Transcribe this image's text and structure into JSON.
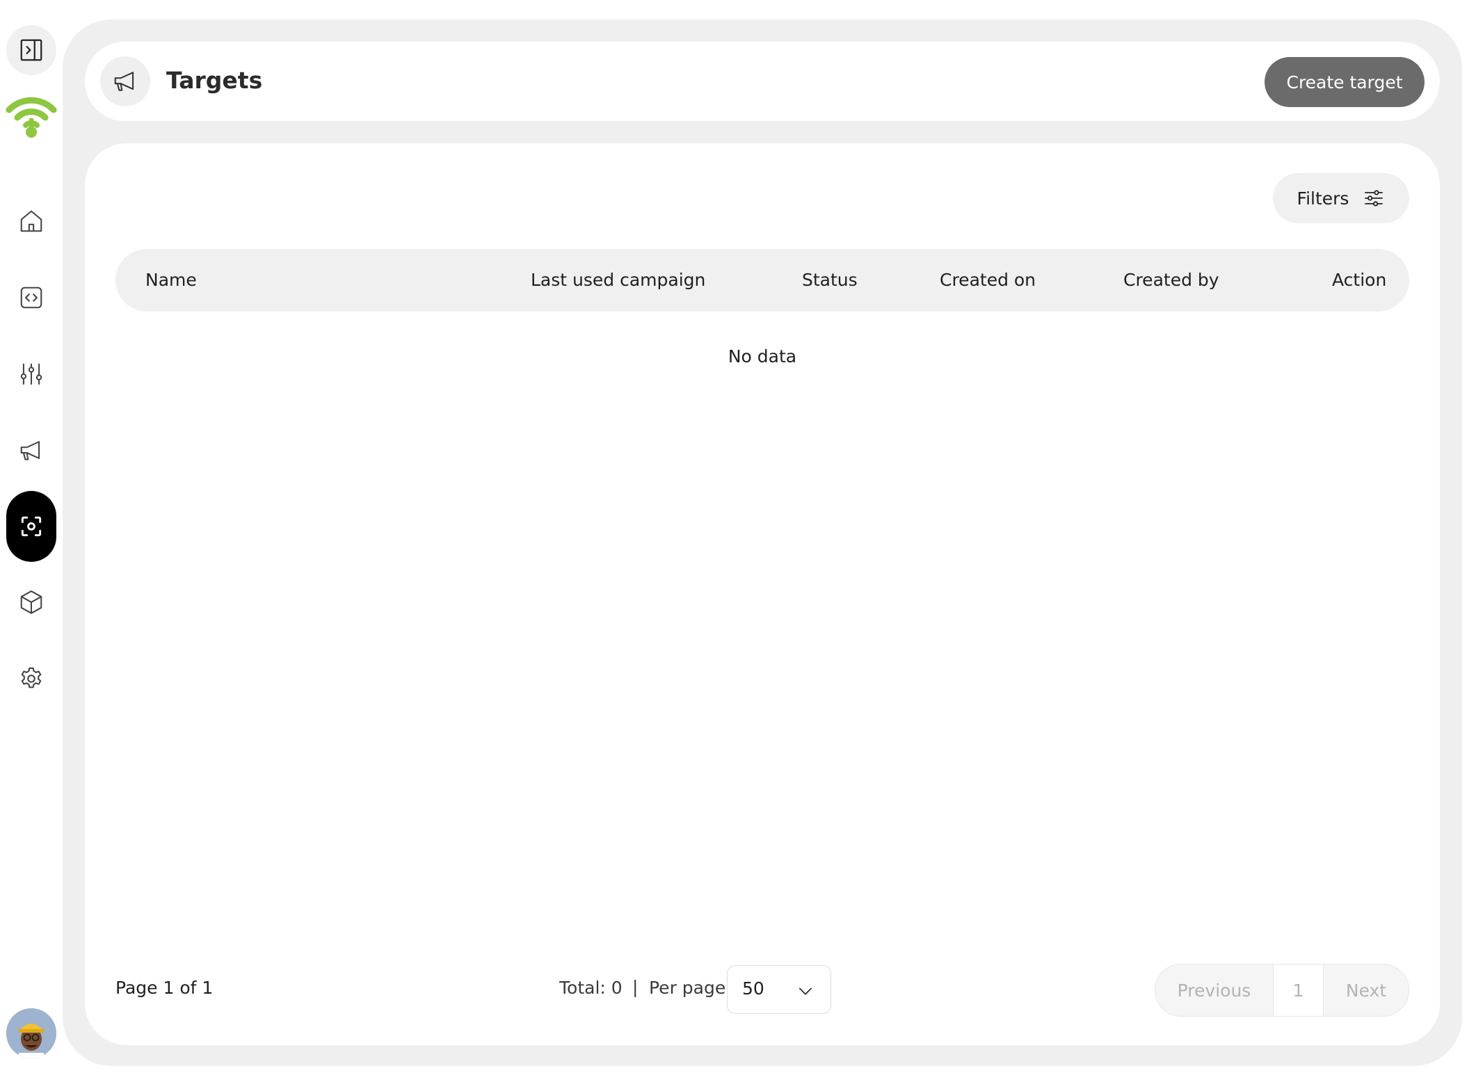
{
  "sidebar": {
    "items": [
      {
        "name": "home-icon"
      },
      {
        "name": "code-icon"
      },
      {
        "name": "sliders-icon"
      },
      {
        "name": "megaphone-icon"
      },
      {
        "name": "scan-target-icon",
        "active": true
      },
      {
        "name": "cube-icon"
      },
      {
        "name": "gear-icon"
      }
    ],
    "logo": "wifi-logo",
    "brand_color": "#8dc63f"
  },
  "header": {
    "title": "Targets",
    "icon": "megaphone-icon",
    "create_label": "Create target"
  },
  "toolbar": {
    "filters_label": "Filters"
  },
  "table": {
    "columns": [
      "Name",
      "Last used campaign",
      "Status",
      "Created on",
      "Created by",
      "Action"
    ],
    "rows": [],
    "empty_text": "No data"
  },
  "pagination": {
    "page_info": "Page 1 of 1",
    "total": "Total: 0",
    "separator": "|",
    "per_page_label": "Per page:",
    "per_page_value": "50",
    "previous_label": "Previous",
    "current_page": "1",
    "next_label": "Next"
  },
  "colors": {
    "accent": "#8dc63f",
    "primary_button": "#6b6b6b",
    "active_nav": "#000000",
    "shell": "#efefef"
  }
}
